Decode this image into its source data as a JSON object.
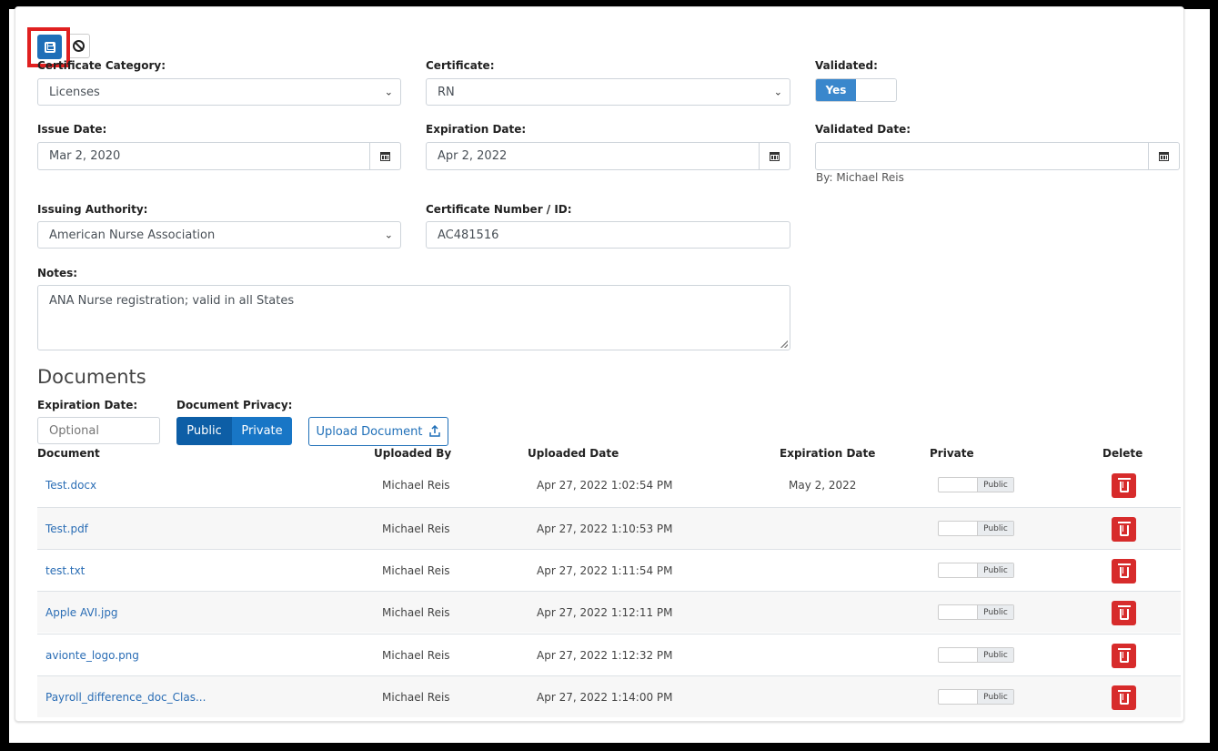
{
  "form": {
    "certificate_category": {
      "label": "Certificate Category:",
      "value": "Licenses"
    },
    "certificate": {
      "label": "Certificate:",
      "value": "RN"
    },
    "validated": {
      "label": "Validated:",
      "value": "Yes"
    },
    "issue_date": {
      "label": "Issue Date:",
      "value": "Mar 2, 2020"
    },
    "expiration_date": {
      "label": "Expiration Date:",
      "value": "Apr 2, 2022"
    },
    "validated_date": {
      "label": "Validated Date:",
      "value": "",
      "by": "By: Michael Reis"
    },
    "issuing_authority": {
      "label": "Issuing Authority:",
      "value": "American Nurse Association"
    },
    "certificate_number": {
      "label": "Certificate Number / ID:",
      "value": "AC481516"
    },
    "notes": {
      "label": "Notes:",
      "value": "ANA Nurse registration; valid in all States"
    }
  },
  "documents": {
    "title": "Documents",
    "expiration_label": "Expiration Date:",
    "expiration_placeholder": "Optional",
    "privacy_label": "Document Privacy:",
    "privacy_options": [
      "Public",
      "Private"
    ],
    "upload_label": "Upload Document",
    "columns": [
      "Document",
      "Uploaded By",
      "Uploaded Date",
      "Expiration Date",
      "Private",
      "Delete"
    ],
    "rows": [
      {
        "name": "Test.docx",
        "by": "Michael Reis",
        "date": "Apr 27, 2022 1:02:54 PM",
        "exp": "May 2, 2022",
        "privacy": "Public"
      },
      {
        "name": "Test.pdf",
        "by": "Michael Reis",
        "date": "Apr 27, 2022 1:10:53 PM",
        "exp": "",
        "privacy": "Public"
      },
      {
        "name": "test.txt",
        "by": "Michael Reis",
        "date": "Apr 27, 2022 1:11:54 PM",
        "exp": "",
        "privacy": "Public"
      },
      {
        "name": "Apple AVI.jpg",
        "by": "Michael Reis",
        "date": "Apr 27, 2022 1:12:11 PM",
        "exp": "",
        "privacy": "Public"
      },
      {
        "name": "avionte_logo.png",
        "by": "Michael Reis",
        "date": "Apr 27, 2022 1:12:32 PM",
        "exp": "",
        "privacy": "Public"
      },
      {
        "name": "Payroll_difference_doc_Clas...",
        "by": "Michael Reis",
        "date": "Apr 27, 2022 1:14:00 PM",
        "exp": "",
        "privacy": "Public"
      }
    ]
  },
  "colors": {
    "primary": "#1f6fb8",
    "danger": "#d72b2b",
    "highlight": "#e02020"
  },
  "icons": {
    "save": "floppy-disk-icon",
    "cancel": "ban-icon",
    "calendar": "calendar-icon",
    "upload": "upload-icon",
    "delete": "trash-icon"
  }
}
